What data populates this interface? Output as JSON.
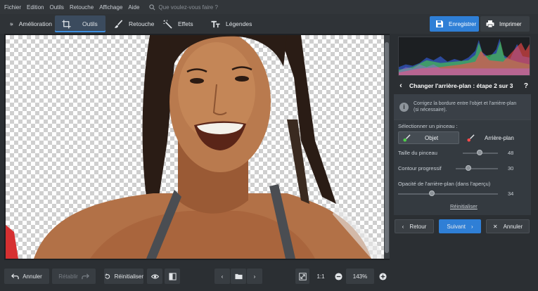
{
  "menu": {
    "items": [
      "Fichier",
      "Edition",
      "Outils",
      "Retouche",
      "Affichage",
      "Aide"
    ],
    "search_placeholder": "Que voulez-vous faire ?"
  },
  "toolbar": {
    "tabs": [
      {
        "label": "Amélioration",
        "icon": "sliders-icon",
        "active": false
      },
      {
        "label": "Outils",
        "icon": "crop-icon",
        "active": true
      },
      {
        "label": "Retouche",
        "icon": "brush-icon",
        "active": false
      },
      {
        "label": "Effets",
        "icon": "magic-wand-icon",
        "active": false
      },
      {
        "label": "Légendes",
        "icon": "text-icon",
        "active": false
      }
    ],
    "save_label": "Enregistrer",
    "print_label": "Imprimer"
  },
  "panel": {
    "step_title": "Changer l'arrière-plan : étape 2 sur 3",
    "help": "?",
    "info_line1": "Corrigez la bordure entre l'objet et l'arrière-plan",
    "info_line2": "(si nécessaire).",
    "brush_heading": "Sélectionner un pinceau :",
    "brush_object": "Objet",
    "brush_background": "Arrière-plan",
    "brush_size_label": "Taille du pinceau",
    "brush_size_value": "48",
    "brush_size_fraction": 0.48,
    "feather_label": "Contour progressif",
    "feather_value": "30",
    "feather_fraction": 0.3,
    "opacity_label": "Opacité de l'arrière-plan (dans l'aperçu)",
    "opacity_value": "34",
    "opacity_fraction": 0.34,
    "reset_label": "Réinitialiser",
    "back_label": "Retour",
    "next_label": "Suivant",
    "cancel_label": "Annuler"
  },
  "bottom": {
    "undo_label": "Annuler",
    "redo_label": "Rétablir",
    "reset_label": "Réinitialiser",
    "ratio_label": "1:1",
    "zoom_value": "143%"
  },
  "colors": {
    "accent": "#2f7fd6",
    "active_tab": "#3b4b5e",
    "panel_bg": "#343a40"
  }
}
